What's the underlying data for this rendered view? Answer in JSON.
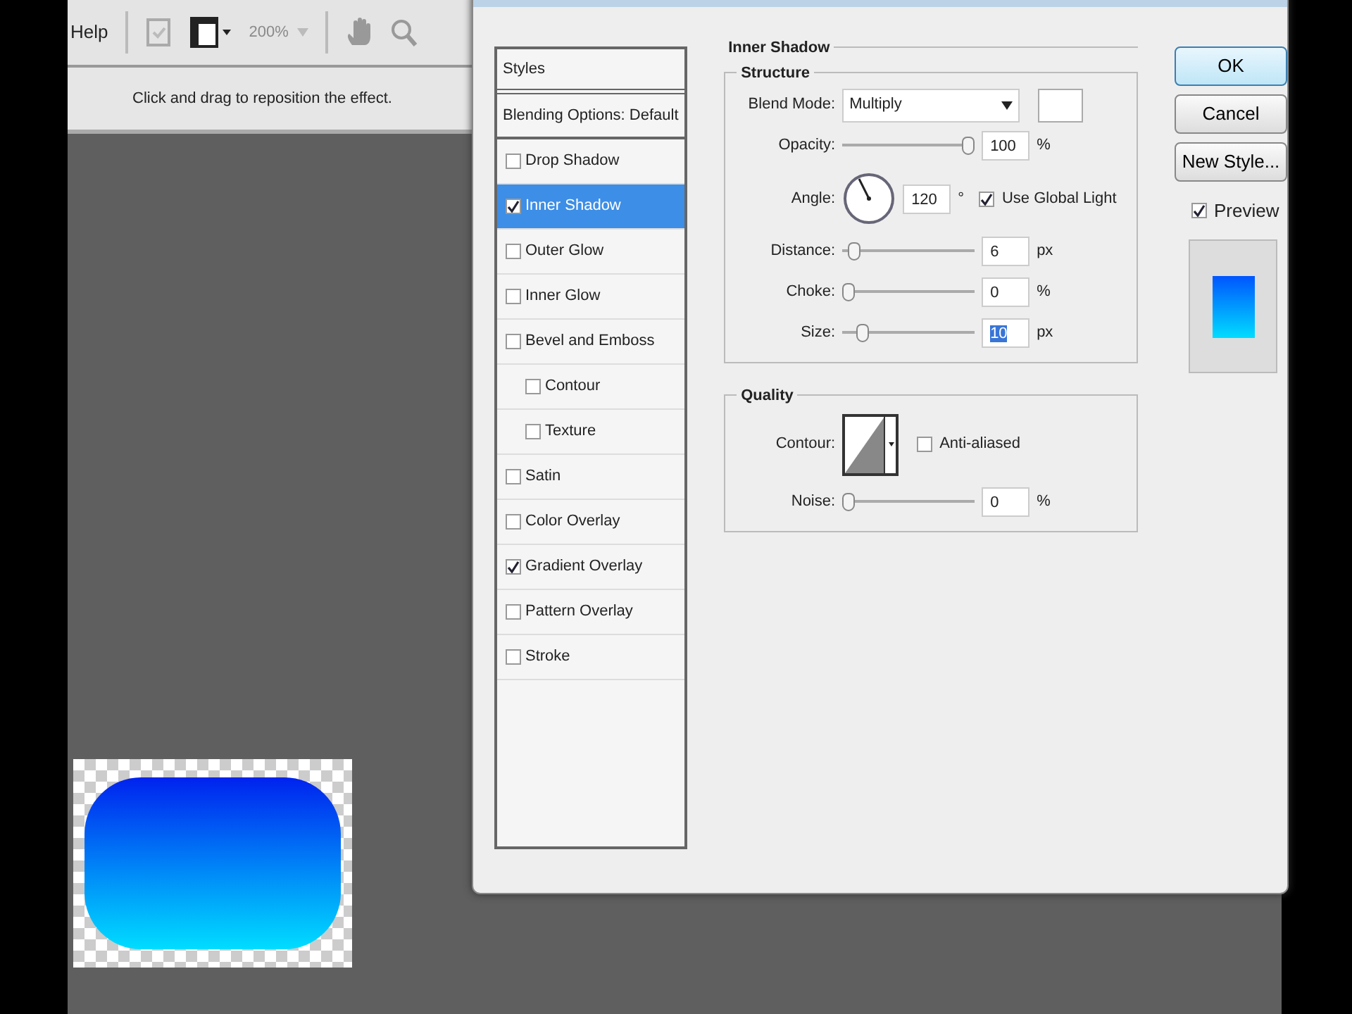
{
  "toolbar": {
    "menu_label": "Help",
    "zoom": "200%"
  },
  "options_bar": {
    "hint": "Click and drag to reposition the effect."
  },
  "dialog": {
    "styles_header": "Styles",
    "blending_options": "Blending Options: Default",
    "styles": [
      {
        "label": "Drop Shadow",
        "checked": false,
        "selected": false
      },
      {
        "label": "Inner Shadow",
        "checked": true,
        "selected": true
      },
      {
        "label": "Outer Glow",
        "checked": false,
        "selected": false
      },
      {
        "label": "Inner Glow",
        "checked": false,
        "selected": false
      },
      {
        "label": "Bevel and Emboss",
        "checked": false,
        "selected": false,
        "children": [
          {
            "label": "Contour",
            "checked": false,
            "selected": false
          },
          {
            "label": "Texture",
            "checked": false,
            "selected": false
          }
        ]
      },
      {
        "label": "Satin",
        "checked": false,
        "selected": false
      },
      {
        "label": "Color Overlay",
        "checked": false,
        "selected": false
      },
      {
        "label": "Gradient Overlay",
        "checked": true,
        "selected": false
      },
      {
        "label": "Pattern Overlay",
        "checked": false,
        "selected": false
      },
      {
        "label": "Stroke",
        "checked": false,
        "selected": false
      }
    ],
    "panel": {
      "title": "Inner Shadow",
      "structure": {
        "title": "Structure",
        "blend_mode": {
          "label": "Blend Mode:",
          "value": "Multiply"
        },
        "opacity": {
          "label": "Opacity:",
          "level": 1,
          "value": "100",
          "unit": "%"
        },
        "angle": {
          "label": "Angle:",
          "value": "120",
          "unit": "°",
          "use_global_light": {
            "label": "Use Global Light",
            "checked": true
          }
        },
        "distance": {
          "label": "Distance:",
          "level": 0.05,
          "value": "6",
          "unit": "px"
        },
        "choke": {
          "label": "Choke:",
          "level": 0,
          "value": "0",
          "unit": "%"
        },
        "size": {
          "label": "Size:",
          "level": 0.12,
          "value": "10",
          "unit": "px",
          "selected": true
        }
      },
      "quality": {
        "title": "Quality",
        "contour": {
          "label": "Contour:"
        },
        "anti_aliased": {
          "label": "Anti-aliased",
          "checked": false
        },
        "noise": {
          "label": "Noise:",
          "level": 0,
          "value": "0",
          "unit": "%"
        }
      }
    },
    "buttons": [
      {
        "label": "OK",
        "default": true
      },
      {
        "label": "Cancel",
        "default": false
      },
      {
        "label": "New Style...",
        "default": false
      }
    ],
    "preview": {
      "label": "Preview",
      "checked": true
    }
  }
}
